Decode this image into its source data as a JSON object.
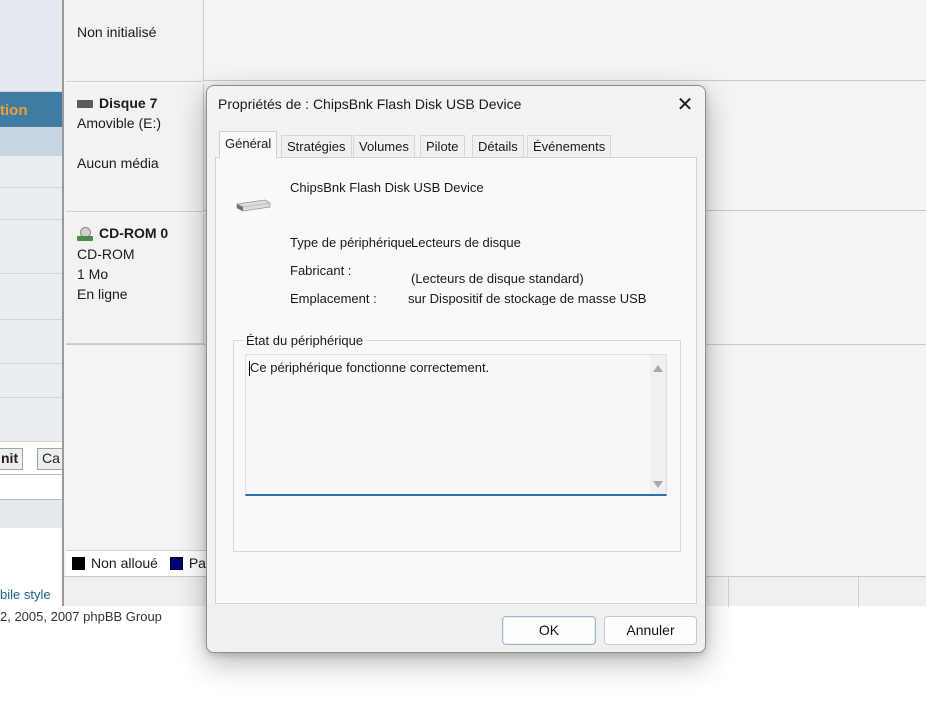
{
  "background_page": {
    "header_fragment": "tion",
    "buttons": [
      "nit",
      "Ca"
    ],
    "link_fragment": "bile style",
    "copyright_fragment": "2, 2005, 2007 phpBB Group"
  },
  "disk_manager": {
    "disk_prev_status": "Non initialisé",
    "disk7": {
      "title": "Disque 7",
      "type": "Amovible (E:)",
      "media": "Aucun média"
    },
    "cdrom0": {
      "title": "CD-ROM 0",
      "type": "CD-ROM",
      "size": "1 Mo",
      "status": "En ligne"
    },
    "legend": [
      {
        "label": "Non alloué",
        "color": "#000000"
      },
      {
        "label": "Pa",
        "color": "#000080"
      }
    ]
  },
  "dialog": {
    "title": "Propriétés de : ChipsBnk Flash Disk USB Device",
    "close_glyph": "✕",
    "tabs": [
      "Général",
      "Stratégies",
      "Volumes",
      "Pilote",
      "Détails",
      "Événements"
    ],
    "active_tab": "Général",
    "device_name": "ChipsBnk Flash Disk USB Device",
    "device_icon": "usb-drive-icon",
    "fields": {
      "type_label": "Type de périphérique",
      "type_value": "Lecteurs de disque",
      "manufacturer_label": "Fabricant :",
      "manufacturer_value": "(Lecteurs de disque standard)",
      "location_label": "Emplacement :",
      "location_value": "sur Dispositif de stockage de masse USB"
    },
    "status_group_label": "État du périphérique",
    "status_text": "Ce périphérique fonctionne correctement.",
    "buttons": {
      "ok": "OK",
      "cancel": "Annuler"
    }
  }
}
